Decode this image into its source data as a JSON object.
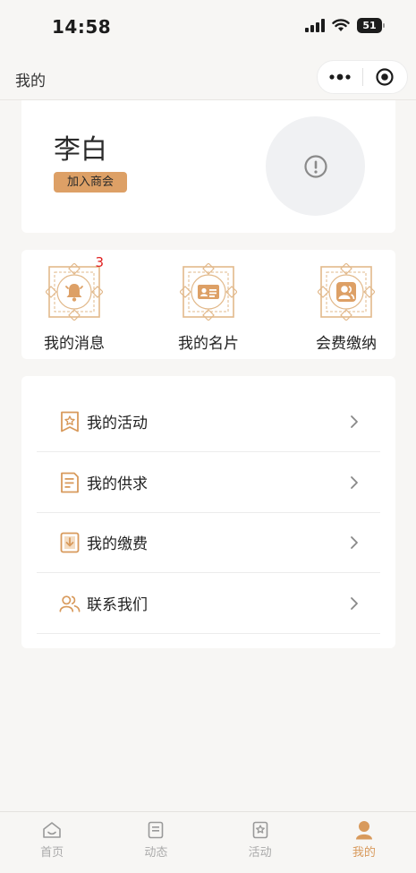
{
  "status_bar": {
    "time": "14:58",
    "battery": "51"
  },
  "navbar": {
    "title": "我的"
  },
  "profile": {
    "name": "李白",
    "badge": "加入商会"
  },
  "shortcuts": [
    {
      "label": "我的消息",
      "icon": "bell-icon",
      "count": "3"
    },
    {
      "label": "我的名片",
      "icon": "id-card-icon"
    },
    {
      "label": "会费缴纳",
      "icon": "member-icon"
    }
  ],
  "menu": [
    {
      "label": "我的活动",
      "icon": "bookmark-star-icon"
    },
    {
      "label": "我的供求",
      "icon": "document-icon"
    },
    {
      "label": "我的缴费",
      "icon": "payment-download-icon"
    },
    {
      "label": "联系我们",
      "icon": "contacts-icon"
    }
  ],
  "tabbar": {
    "tabs": [
      {
        "label": "首页",
        "icon": "home-icon"
      },
      {
        "label": "动态",
        "icon": "news-icon"
      },
      {
        "label": "活动",
        "icon": "activity-icon"
      },
      {
        "label": "我的",
        "icon": "user-icon"
      }
    ],
    "active_index": 3
  },
  "colors": {
    "accent": "#d89a5c",
    "badge_bg": "#dda066",
    "badge_count": "#e02020",
    "background": "#f7f6f4"
  }
}
